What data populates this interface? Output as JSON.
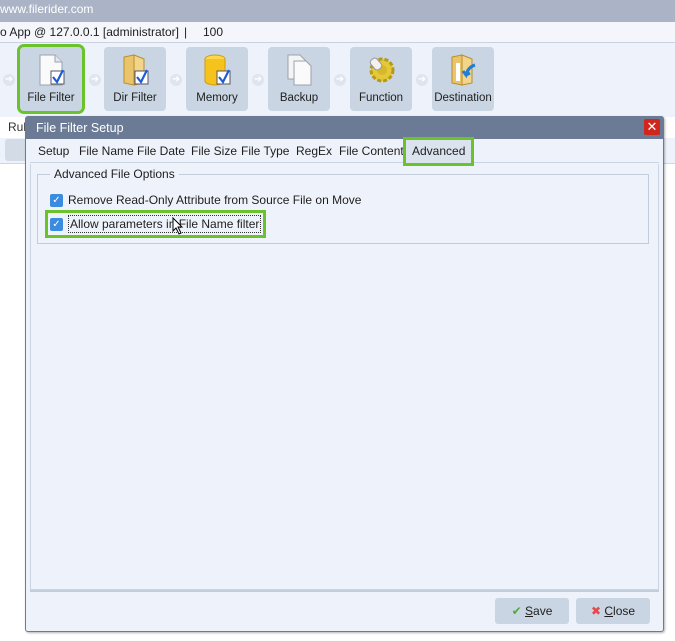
{
  "browser": {
    "url_text": "www.filerider.com"
  },
  "app": {
    "title": "o App @ 127.0.0.1 [administrator]",
    "separator": "|",
    "value": "100"
  },
  "toolbar": {
    "items": [
      {
        "label": "File Filter",
        "icon": "file-check-icon",
        "active": true
      },
      {
        "label": "Dir Filter",
        "icon": "folder-check-icon",
        "active": false
      },
      {
        "label": "Memory",
        "icon": "database-check-icon",
        "active": false
      },
      {
        "label": "Backup",
        "icon": "files-copy-icon",
        "active": false
      },
      {
        "label": "Function",
        "icon": "gear-icon",
        "active": false
      },
      {
        "label": "Destination",
        "icon": "folder-arrow-icon",
        "active": false
      }
    ]
  },
  "background": {
    "rules_label": "Rul"
  },
  "dialog": {
    "title": "File Filter Setup",
    "close_icon": "close-icon",
    "tabs": [
      {
        "label": "Setup"
      },
      {
        "label": "File Name"
      },
      {
        "label": "File Date"
      },
      {
        "label": "File Size"
      },
      {
        "label": "File Type"
      },
      {
        "label": "RegEx"
      },
      {
        "label": "File Contents"
      },
      {
        "label": "Advanced",
        "active": true
      }
    ],
    "group": {
      "title": "Advanced File Options",
      "options": [
        {
          "label": "Remove Read-Only Attribute from Source File on Move",
          "checked": true
        },
        {
          "label": "Allow parameters in File Name filter",
          "checked": true,
          "focused": true
        }
      ]
    },
    "buttons": {
      "save": {
        "mnemonic": "S",
        "rest": "ave",
        "icon": "checkmark-icon"
      },
      "close": {
        "mnemonic": "C",
        "rest": "lose",
        "icon": "x-icon"
      }
    }
  }
}
